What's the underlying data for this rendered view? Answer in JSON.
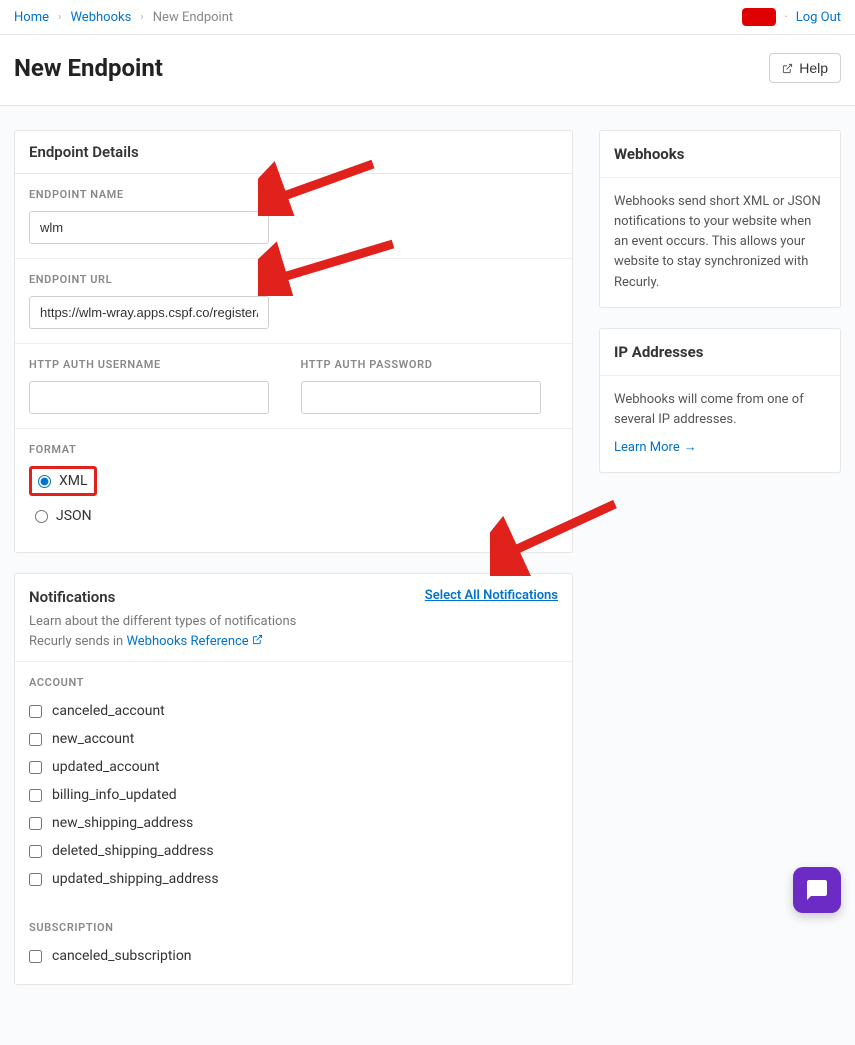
{
  "breadcrumbs": {
    "home": "Home",
    "webhooks": "Webhooks",
    "current": "New Endpoint"
  },
  "top": {
    "logout": "Log Out"
  },
  "header": {
    "title": "New Endpoint",
    "help": "Help"
  },
  "endpoint_panel": {
    "title": "Endpoint Details",
    "name_label": "ENDPOINT NAME",
    "name_value": "wlm",
    "url_label": "ENDPOINT URL",
    "url_value": "https://wlm-wray.apps.cspf.co/register/Bl",
    "auth_user_label": "HTTP AUTH USERNAME",
    "auth_user_value": "",
    "auth_pass_label": "HTTP AUTH PASSWORD",
    "auth_pass_value": "",
    "format_label": "FORMAT",
    "format_options": {
      "xml": "XML",
      "json": "JSON"
    }
  },
  "notifications_panel": {
    "title": "Notifications",
    "subtitle_prefix": "Learn about the different types of notifications Recurly sends in ",
    "subtitle_link": "Webhooks Reference",
    "select_all": "Select All Notifications",
    "groups": [
      {
        "label": "ACCOUNT",
        "items": [
          "canceled_account",
          "new_account",
          "updated_account",
          "billing_info_updated",
          "new_shipping_address",
          "deleted_shipping_address",
          "updated_shipping_address"
        ]
      },
      {
        "label": "SUBSCRIPTION",
        "items": [
          "canceled_subscription"
        ]
      }
    ]
  },
  "sidebar": {
    "webhooks": {
      "title": "Webhooks",
      "body": "Webhooks send short XML or JSON notifications to your website when an event occurs. This allows your website to stay synchronized with Recurly."
    },
    "ip": {
      "title": "IP Addresses",
      "body": "Webhooks will come from one of several IP addresses.",
      "learn_more": "Learn More"
    }
  }
}
